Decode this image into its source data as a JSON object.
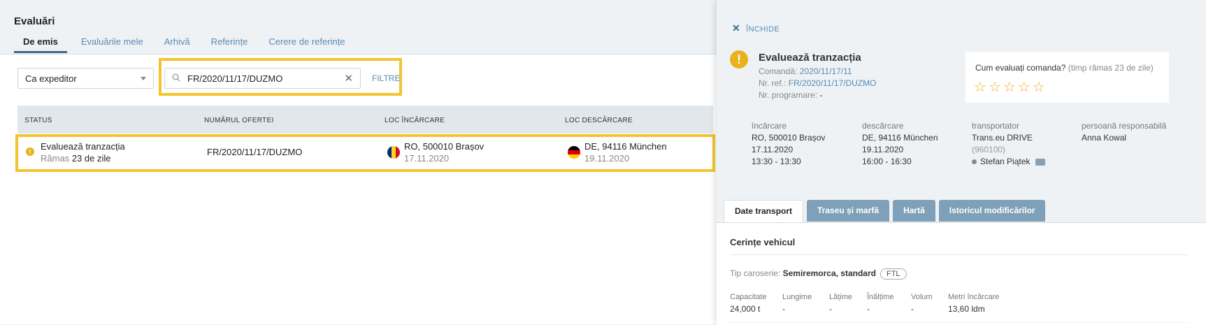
{
  "page": {
    "title": "Evaluări",
    "tabs": [
      "De emis",
      "Evaluările mele",
      "Arhivă",
      "Referințe",
      "Cerere de referințe"
    ]
  },
  "filters": {
    "role_select": "Ca expeditor",
    "search_value": "FR/2020/11/17/DUZMO",
    "filters_link": "FILTRE"
  },
  "table": {
    "columns": [
      "STATUS",
      "NUMĂRUL OFERTEI",
      "LOC ÎNCĂRCARE",
      "LOC DESCĂRCARE"
    ],
    "rows": [
      {
        "status": "Evaluează tranzacția",
        "remaining_prefix": "Rămas",
        "remaining_value": "23 de zile",
        "offer_number": "FR/2020/11/17/DUZMO",
        "loading_place": "RO, 500010 Brașov",
        "loading_date": "17.11.2020",
        "unloading_place": "DE, 94116 München",
        "unloading_date": "19.11.2020"
      }
    ]
  },
  "panel": {
    "close_label": "ÎNCHIDE",
    "title": "Evaluează tranzacția",
    "order_label": "Comandă:",
    "order_value": "2020/11/17/11",
    "ref_label": "Nr. ref.:",
    "ref_value": "FR/2020/11/17/DUZMO",
    "schedule_label": "Nr. programare:",
    "schedule_value": "-",
    "rating_question": "Cum evaluați comanda?",
    "rating_time": "(timp rămas 23 de zile)",
    "rating_stars": "☆☆☆☆☆",
    "loading": {
      "header": "încărcare",
      "place": "RO, 500010 Brașov",
      "date": "17.11.2020",
      "time": "13:30 - 13:30"
    },
    "unloading": {
      "header": "descărcare",
      "place": "DE, 94116 München",
      "date": "19.11.2020",
      "time": "16:00 - 16:30"
    },
    "carrier": {
      "header": "transportator",
      "name": "Trans.eu DRIVE",
      "id": "(960100)",
      "person": "Stefan Piątek"
    },
    "responsible": {
      "header": "persoană responsabilă",
      "name": "Anna Kowal"
    },
    "tabs": [
      "Date transport",
      "Traseu și marfă",
      "Hartă",
      "Istoricul modificărilor"
    ],
    "section_title": "Cerințe vehicul",
    "body_type_label": "Tip caroserie:",
    "body_type_value": "Semiremorca, standard",
    "body_badge": "FTL",
    "dimensions": [
      {
        "label": "Capacitate",
        "value": "24,000 t"
      },
      {
        "label": "Lungime",
        "value": "-"
      },
      {
        "label": "Lățime",
        "value": "-"
      },
      {
        "label": "Înălțime",
        "value": "-"
      },
      {
        "label": "Volum",
        "value": "-"
      },
      {
        "label": "Metri încărcare",
        "value": "13,60 ldm"
      }
    ]
  },
  "colors": {
    "accent": "#5a8bb3",
    "highlight": "#f4c430",
    "warning": "#e9b21b",
    "tab_inactive": "#7ea1b9"
  }
}
